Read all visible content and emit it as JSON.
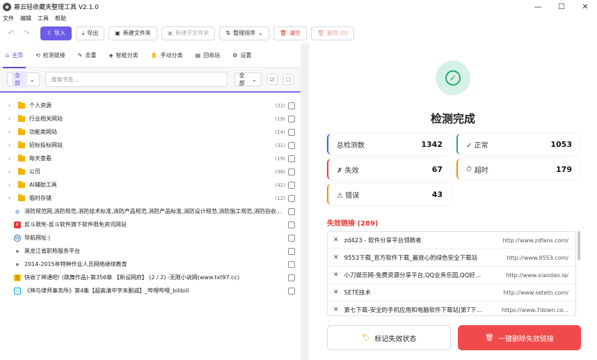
{
  "window": {
    "title": "慕云轻收藏夹整理工具 V2.1.0",
    "controls": [
      "—",
      "☐",
      "✕"
    ]
  },
  "menu": [
    "文件",
    "编辑",
    "工具",
    "帮助"
  ],
  "toolbar": {
    "import": "导入",
    "export": "导出",
    "new_folder": "新建文件夹",
    "new_subfolder": "新建子文件夹",
    "sort": "整理排序",
    "clear": "清空",
    "delete": "删除 (0)"
  },
  "tabs": [
    {
      "label": "主页",
      "icon": "home-icon"
    },
    {
      "label": "检测链接",
      "icon": "link-check-icon"
    },
    {
      "label": "去重",
      "icon": "broom-icon"
    },
    {
      "label": "智能分类",
      "icon": "brain-icon"
    },
    {
      "label": "手动分类",
      "icon": "hand-icon"
    },
    {
      "label": "回收站",
      "icon": "trash-icon"
    },
    {
      "label": "设置",
      "icon": "gear-icon"
    }
  ],
  "filter": {
    "scope": "全部",
    "search_placeholder": "搜索书签...",
    "type": "全部"
  },
  "folders": [
    {
      "label": "个人资源",
      "count": "(22)"
    },
    {
      "label": "行业相关网站",
      "count": "(19)"
    },
    {
      "label": "功能类网站",
      "count": "(14)"
    },
    {
      "label": "招标投标网站",
      "count": "(31)"
    },
    {
      "label": "每天查看",
      "count": "(19)"
    },
    {
      "label": "公司",
      "count": "(38)"
    },
    {
      "label": "AI辅助工具",
      "count": "(42)"
    },
    {
      "label": "临时存储",
      "count": "(12)"
    }
  ],
  "bookmarks": [
    {
      "label": "消防规范网,消防规范,消防技术标准,消防产品规范,消防产品标准,消防设计规范,消防施工规范,消防验收...",
      "icon": "globe-icon"
    },
    {
      "label": "反斗限免-反斗软件旗下软件限免资讯网站",
      "icon": "fandou-icon"
    },
    {
      "label": "导航网址 |",
      "icon": "wordpress-icon"
    },
    {
      "label": "黑龙江省职称服务平台",
      "icon": "dot"
    },
    {
      "label": "2014-2015年特种作业人员网络继续教育",
      "icon": "dot"
    },
    {
      "label": "快收了神通吧! (跳舞作品)-第356章 【新设网府】 (2 / 2) -无限小说网(www.txt97.cc)",
      "icon": "novel-icon"
    },
    {
      "label": "《神与律师事务所》第4集【超高清中字未删减】_哔哩哔哩_bilibili",
      "icon": "bilibili-icon"
    }
  ],
  "result": {
    "title": "检测完成",
    "stats": {
      "total_label": "总检测数",
      "total": "1342",
      "ok_label": "✓ 正常",
      "ok": "1053",
      "invalid_label": "✗ 失效",
      "invalid": "67",
      "timeout_label": "超时",
      "timeout": "179",
      "error_label": "⚠ 错误",
      "error": "43"
    },
    "invalid_title": "失效链接 (289)",
    "invalid_links": [
      {
        "title": "zd423 - 软件分享平台领跑者",
        "url": "http://www.zdfans.com/"
      },
      {
        "title": "9553下载_官方软件下载_最放心的绿色安全下载站",
        "url": "http://www.9553.com/"
      },
      {
        "title": "小刀娱乐网-免费资源分享平台,QQ业务乐园,QQ好荟...",
        "url": "http://www.xiaodao.la/"
      },
      {
        "title": "SETE技术",
        "url": "http://www.setetn.com/"
      },
      {
        "title": "第七下载-安全的手机应用和电脑软件下载站|第7下...",
        "url": "https://www.7down.co..."
      }
    ],
    "mark_button": "标记失效状态",
    "delete_button": "一键删除失效链接"
  },
  "colors": {
    "accent": "#6c5ce7",
    "success": "#26a86b",
    "danger": "#f04a4a",
    "warning": "#fb8c00"
  }
}
